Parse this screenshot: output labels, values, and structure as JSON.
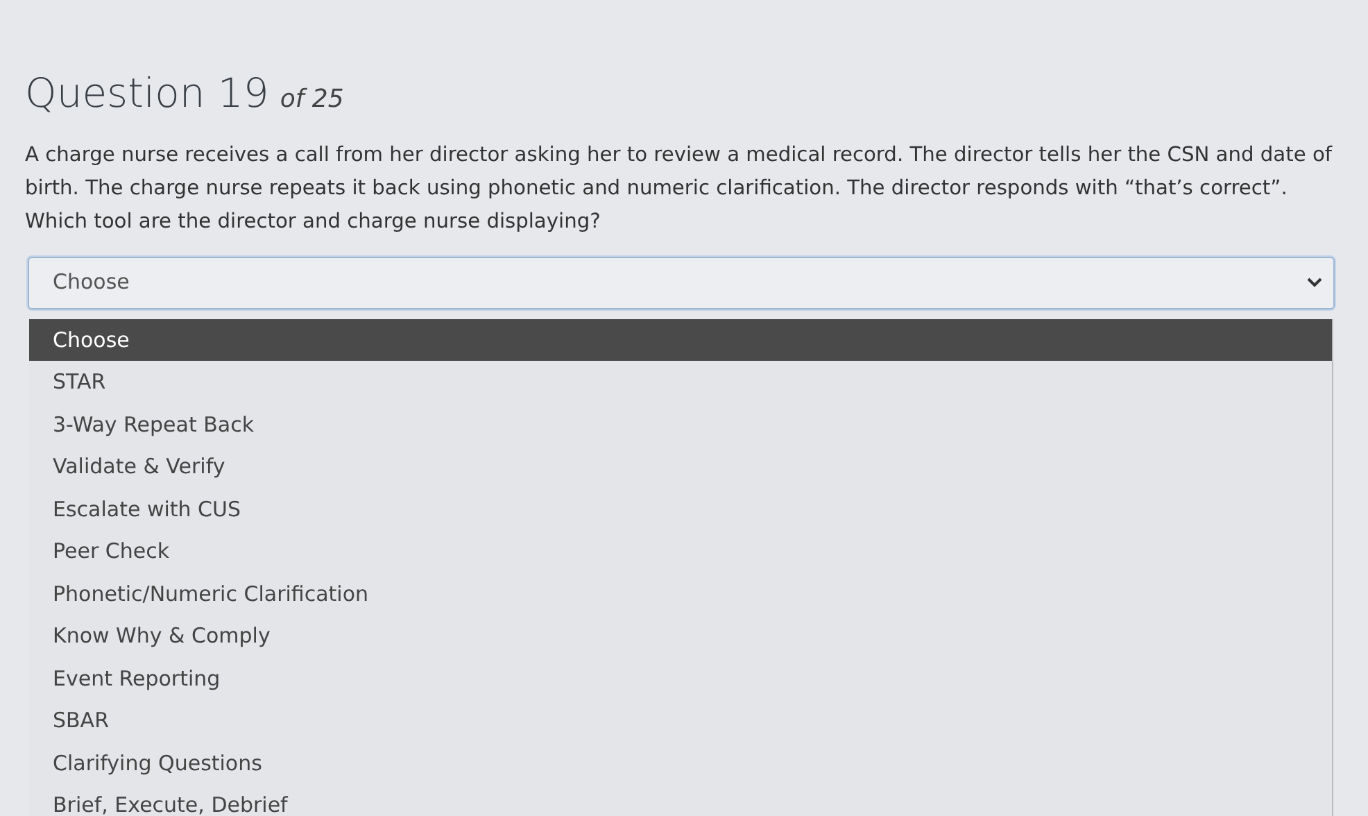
{
  "question": {
    "title": "Question 19",
    "count": "of 25",
    "text": "A charge nurse receives a call from her director asking her to review a medical record. The director tells her the CSN and date of birth. The charge nurse repeats it back using phonetic and numeric clarification. The director responds with “that’s correct”. Which tool are the director and charge nurse displaying?"
  },
  "select": {
    "value": "Choose",
    "expanded": true
  },
  "options": [
    {
      "label": "Choose",
      "selected": true
    },
    {
      "label": "STAR",
      "selected": false
    },
    {
      "label": "3-Way Repeat Back",
      "selected": false
    },
    {
      "label": "Validate & Verify",
      "selected": false
    },
    {
      "label": "Escalate with CUS",
      "selected": false
    },
    {
      "label": "Peer Check",
      "selected": false
    },
    {
      "label": "Phonetic/Numeric Clarification",
      "selected": false
    },
    {
      "label": "Know Why & Comply",
      "selected": false
    },
    {
      "label": "Event Reporting",
      "selected": false
    },
    {
      "label": "SBAR",
      "selected": false
    },
    {
      "label": "Clarifying Questions",
      "selected": false
    },
    {
      "label": "Brief, Execute, Debrief",
      "selected": false
    }
  ]
}
